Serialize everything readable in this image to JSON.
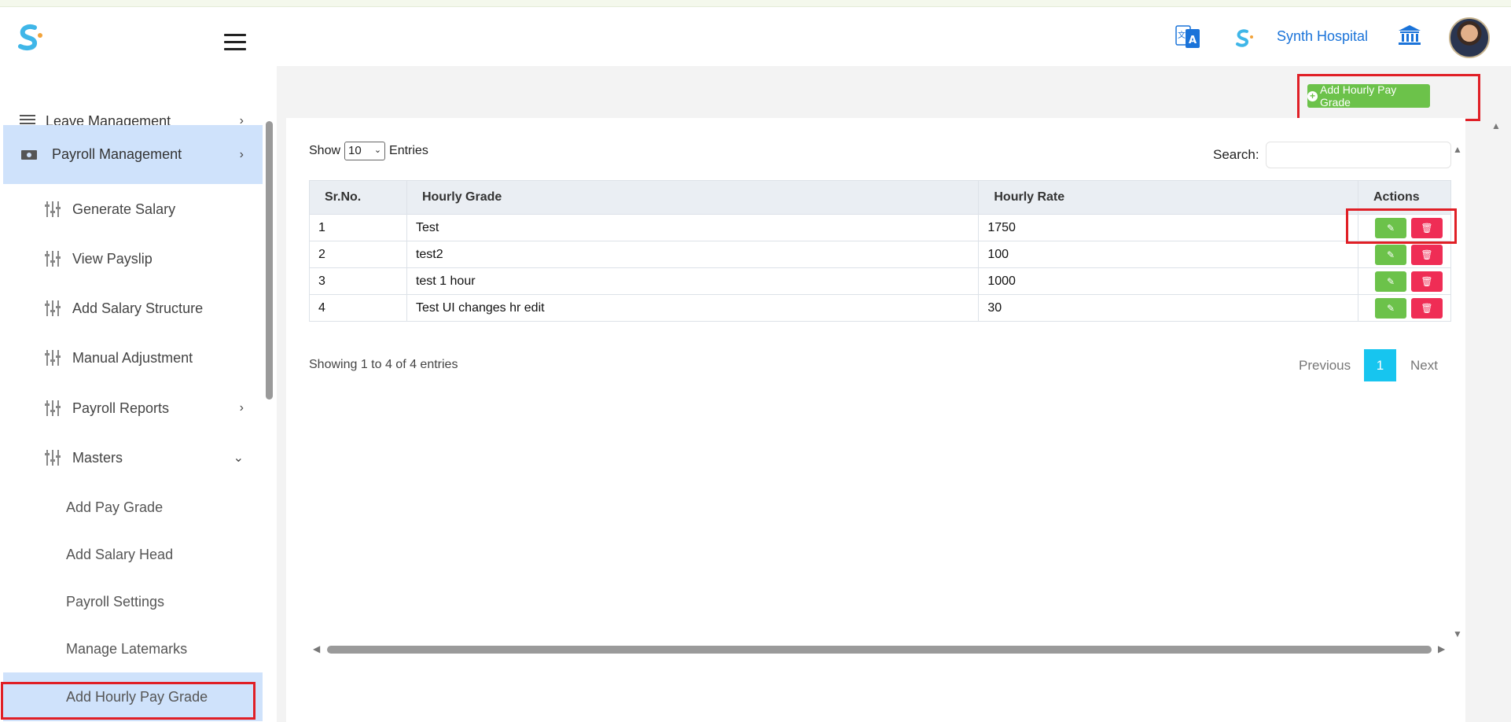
{
  "header": {
    "hospital_name": "Synth Hospital",
    "icons": [
      "logo-icon",
      "menu-icon",
      "translate-icon",
      "hospital-logo-icon",
      "bank-icon",
      "avatar"
    ]
  },
  "sidebar": {
    "items": [
      {
        "label": "Leave Management",
        "icon": "list-icon",
        "chevron": "›"
      },
      {
        "label": "Payroll Management",
        "icon": "money-icon",
        "chevron": "›"
      },
      {
        "label": "Generate Salary",
        "icon": "sliders-icon"
      },
      {
        "label": "View Payslip",
        "icon": "sliders-icon"
      },
      {
        "label": "Add Salary Structure",
        "icon": "sliders-icon"
      },
      {
        "label": "Manual Adjustment",
        "icon": "sliders-icon"
      },
      {
        "label": "Payroll Reports",
        "icon": "sliders-icon",
        "chevron": "›"
      },
      {
        "label": "Masters",
        "icon": "sliders-icon",
        "chevron": "⌄"
      }
    ],
    "masters": [
      "Add Pay Grade",
      "Add Salary Head",
      "Payroll Settings",
      "Manage Latemarks",
      "Add Hourly Pay Grade"
    ]
  },
  "main": {
    "add_button_label": "Add Hourly Pay Grade",
    "show_label": "Show",
    "entries_value": "10",
    "entries_label": "Entries",
    "search_label": "Search:",
    "search_value": "",
    "columns": [
      "Sr.No.",
      "Hourly Grade",
      "Hourly Rate",
      "Actions"
    ],
    "rows": [
      {
        "sr": "1",
        "grade": "Test",
        "rate": "1750"
      },
      {
        "sr": "2",
        "grade": "test2",
        "rate": "100"
      },
      {
        "sr": "3",
        "grade": "test 1 hour",
        "rate": "1000"
      },
      {
        "sr": "4",
        "grade": "Test UI changes hr edit",
        "rate": "30"
      }
    ],
    "info": "Showing 1 to 4 of 4 entries",
    "pagination": {
      "prev": "Previous",
      "current": "1",
      "next": "Next"
    }
  },
  "colors": {
    "accent_green": "#6cc24a",
    "delete_red": "#ef2d55",
    "page_active": "#17c5ef",
    "sidebar_active": "#cfe2fb",
    "highlight_box": "#e01f26"
  }
}
